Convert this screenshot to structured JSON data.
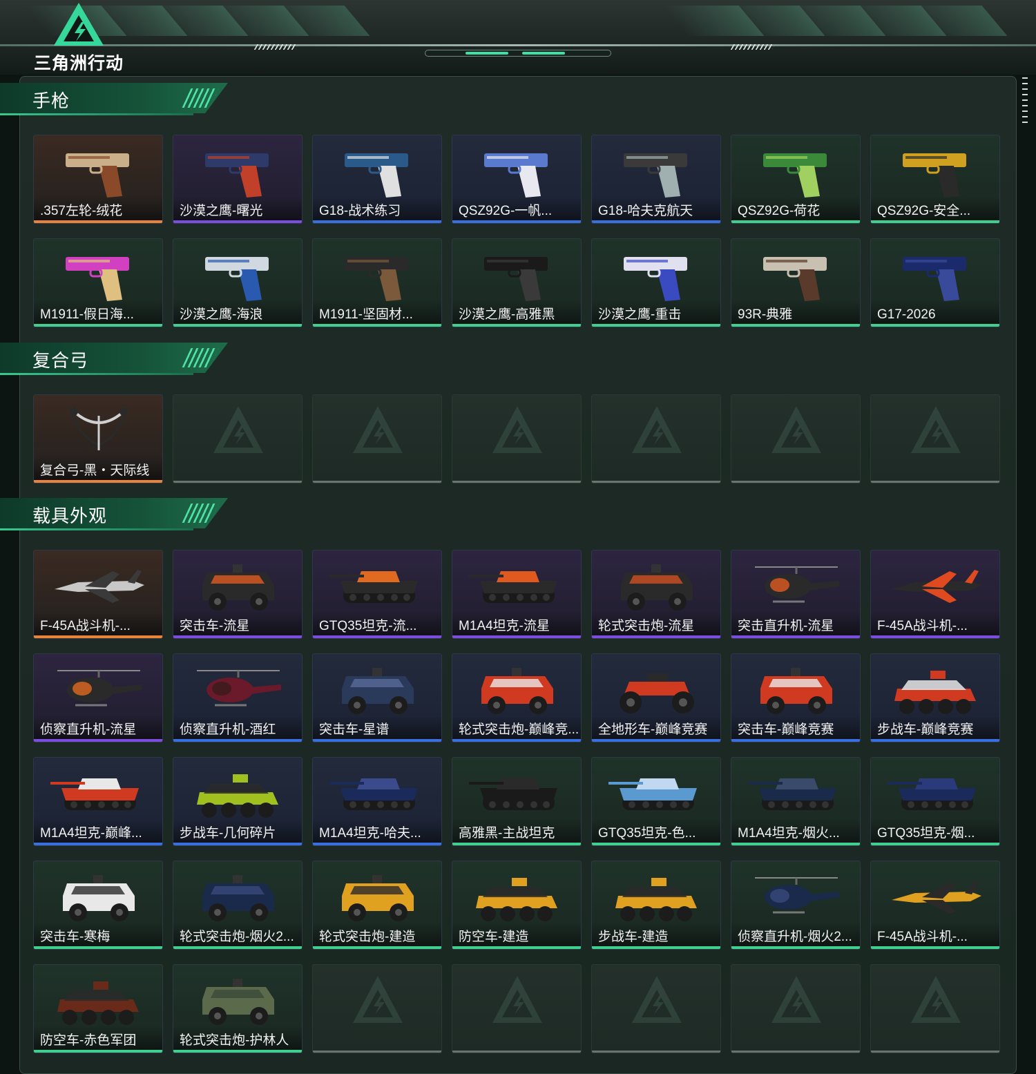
{
  "app": {
    "logo_text": "三角洲行动",
    "accent": "#3fe0a6"
  },
  "rarity_colors": {
    "orange": "#e8833a",
    "purple": "#7b4ee0",
    "blue": "#3a6fe0",
    "green": "#3fd08f"
  },
  "sections": [
    {
      "title": "手枪",
      "rows": [
        [
          {
            "name": ".357左轮-绒花",
            "rarity": "orange",
            "kind": "pistol",
            "c1": "#c9b08a",
            "c2": "#8a4a2a"
          },
          {
            "name": "沙漠之鹰-曙光",
            "rarity": "purple",
            "kind": "pistol",
            "c1": "#2d3a6a",
            "c2": "#c0402a"
          },
          {
            "name": "G18-战术练习",
            "rarity": "blue",
            "kind": "pistol",
            "c1": "#2a5a8a",
            "c2": "#e0e0e0"
          },
          {
            "name": "QSZ92G-一帆...",
            "rarity": "blue",
            "kind": "pistol",
            "c1": "#5a7ad0",
            "c2": "#e8e8f0"
          },
          {
            "name": "G18-哈夫克航天",
            "rarity": "blue",
            "kind": "pistol",
            "c1": "#3a3a3a",
            "c2": "#a0b0b0"
          },
          {
            "name": "QSZ92G-荷花",
            "rarity": "green",
            "kind": "pistol",
            "c1": "#3a8a3a",
            "c2": "#a0d060"
          },
          {
            "name": "QSZ92G-安全...",
            "rarity": "green",
            "kind": "pistol",
            "c1": "#d0a020",
            "c2": "#2a2a2a"
          }
        ],
        [
          {
            "name": "M1911-假日海...",
            "rarity": "green",
            "kind": "pistol",
            "c1": "#d040c0",
            "c2": "#e0c080"
          },
          {
            "name": "沙漠之鹰-海浪",
            "rarity": "green",
            "kind": "pistol",
            "c1": "#d0d8e0",
            "c2": "#2a5ab0"
          },
          {
            "name": "M1911-坚固材...",
            "rarity": "green",
            "kind": "pistol",
            "c1": "#2a2a2a",
            "c2": "#7a5a3a"
          },
          {
            "name": "沙漠之鹰-高雅黑",
            "rarity": "green",
            "kind": "pistol",
            "c1": "#1a1a1a",
            "c2": "#3a3a3a"
          },
          {
            "name": "沙漠之鹰-重击",
            "rarity": "green",
            "kind": "pistol",
            "c1": "#e0e0f0",
            "c2": "#3a4ac0"
          },
          {
            "name": "93R-典雅",
            "rarity": "green",
            "kind": "pistol",
            "c1": "#c8c0b0",
            "c2": "#5a3a2a"
          },
          {
            "name": "G17-2026",
            "rarity": "green",
            "kind": "pistol",
            "c1": "#1a2a6a",
            "c2": "#3a4a9a"
          }
        ]
      ]
    },
    {
      "title": "复合弓",
      "rows": [
        [
          {
            "name": "复合弓-黑・天际线",
            "rarity": "orange",
            "kind": "bow",
            "c1": "#d0d0d0",
            "c2": "#2a2a2a"
          },
          null,
          null,
          null,
          null,
          null,
          null
        ]
      ]
    },
    {
      "title": "载具外观",
      "rows": [
        [
          {
            "name": "F-45A战斗机-...",
            "rarity": "orange",
            "kind": "jet",
            "c1": "#c8c8c8",
            "c2": "#3a3a3a"
          },
          {
            "name": "突击车-流星",
            "rarity": "purple",
            "kind": "truck",
            "c1": "#2a2a2a",
            "c2": "#e05a20"
          },
          {
            "name": "GTQ35坦克-流...",
            "rarity": "purple",
            "kind": "tank",
            "c1": "#2a2a2a",
            "c2": "#e06a20"
          },
          {
            "name": "M1A4坦克-流星",
            "rarity": "purple",
            "kind": "tank",
            "c1": "#2a2a2a",
            "c2": "#e05a20"
          },
          {
            "name": "轮式突击炮-流星",
            "rarity": "purple",
            "kind": "truck",
            "c1": "#2a2a2a",
            "c2": "#d05020"
          },
          {
            "name": "突击直升机-流星",
            "rarity": "purple",
            "kind": "heli",
            "c1": "#2a2a2a",
            "c2": "#e05a20"
          },
          {
            "name": "F-45A战斗机-...",
            "rarity": "purple",
            "kind": "jet",
            "c1": "#2a2a2a",
            "c2": "#e04a20"
          }
        ],
        [
          {
            "name": "侦察直升机-流星",
            "rarity": "purple",
            "kind": "heli",
            "c1": "#2a2a2a",
            "c2": "#e06a20"
          },
          {
            "name": "侦察直升机-酒红",
            "rarity": "blue",
            "kind": "heli",
            "c1": "#6a1a2a",
            "c2": "#3a1a1a"
          },
          {
            "name": "突击车-星谱",
            "rarity": "blue",
            "kind": "truck",
            "c1": "#2a3a5a",
            "c2": "#5a6a9a"
          },
          {
            "name": "轮式突击炮-巅峰竞...",
            "rarity": "blue",
            "kind": "truck",
            "c1": "#d03a20",
            "c2": "#e8e8e8"
          },
          {
            "name": "全地形车-巅峰竞赛",
            "rarity": "blue",
            "kind": "atv",
            "c1": "#d03a20",
            "c2": "#2a2a2a"
          },
          {
            "name": "突击车-巅峰竞赛",
            "rarity": "blue",
            "kind": "truck",
            "c1": "#d03a20",
            "c2": "#e8e8e8"
          },
          {
            "name": "步战车-巅峰竞赛",
            "rarity": "blue",
            "kind": "apc",
            "c1": "#d03a20",
            "c2": "#e8e8e8"
          }
        ],
        [
          {
            "name": "M1A4坦克-巅峰...",
            "rarity": "blue",
            "kind": "tank",
            "c1": "#d03a20",
            "c2": "#e8e8e8"
          },
          {
            "name": "步战车-几何碎片",
            "rarity": "blue",
            "kind": "apc",
            "c1": "#a0c020",
            "c2": "#2a2a2a"
          },
          {
            "name": "M1A4坦克-哈夫...",
            "rarity": "blue",
            "kind": "tank",
            "c1": "#1a2a5a",
            "c2": "#3a4a8a"
          },
          {
            "name": "高雅黑-主战坦克",
            "rarity": "green",
            "kind": "tank",
            "c1": "#1a1a1a",
            "c2": "#2a2a2a"
          },
          {
            "name": "GTQ35坦克-色...",
            "rarity": "green",
            "kind": "tank",
            "c1": "#5a9ad0",
            "c2": "#c0d8f0"
          },
          {
            "name": "M1A4坦克-烟火...",
            "rarity": "green",
            "kind": "tank",
            "c1": "#1a2a4a",
            "c2": "#3a4a6a"
          },
          {
            "name": "GTQ35坦克-烟...",
            "rarity": "green",
            "kind": "tank",
            "c1": "#1a2a5a",
            "c2": "#2a3a7a"
          }
        ],
        [
          {
            "name": "突击车-寒梅",
            "rarity": "green",
            "kind": "truck",
            "c1": "#e8e8e8",
            "c2": "#2a2a2a"
          },
          {
            "name": "轮式突击炮-烟火2...",
            "rarity": "green",
            "kind": "truck",
            "c1": "#1a2a4a",
            "c2": "#3a4a7a"
          },
          {
            "name": "轮式突击炮-建造",
            "rarity": "green",
            "kind": "truck",
            "c1": "#e0a020",
            "c2": "#2a2a2a"
          },
          {
            "name": "防空车-建造",
            "rarity": "green",
            "kind": "apc",
            "c1": "#e0a020",
            "c2": "#2a2a2a"
          },
          {
            "name": "步战车-建造",
            "rarity": "green",
            "kind": "apc",
            "c1": "#e0a020",
            "c2": "#2a2a2a"
          },
          {
            "name": "侦察直升机-烟火2...",
            "rarity": "green",
            "kind": "heli",
            "c1": "#1a2a4a",
            "c2": "#3a4a7a"
          },
          {
            "name": "F-45A战斗机-...",
            "rarity": "green",
            "kind": "jet",
            "c1": "#e0a020",
            "c2": "#2a2a2a"
          }
        ],
        [
          {
            "name": "防空车-赤色军团",
            "rarity": "green",
            "kind": "apc",
            "c1": "#6a2a1a",
            "c2": "#2a2a2a"
          },
          {
            "name": "轮式突击炮-护林人",
            "rarity": "green",
            "kind": "truck",
            "c1": "#5a6a4a",
            "c2": "#3a4a3a"
          },
          null,
          null,
          null,
          null,
          null
        ]
      ]
    }
  ]
}
